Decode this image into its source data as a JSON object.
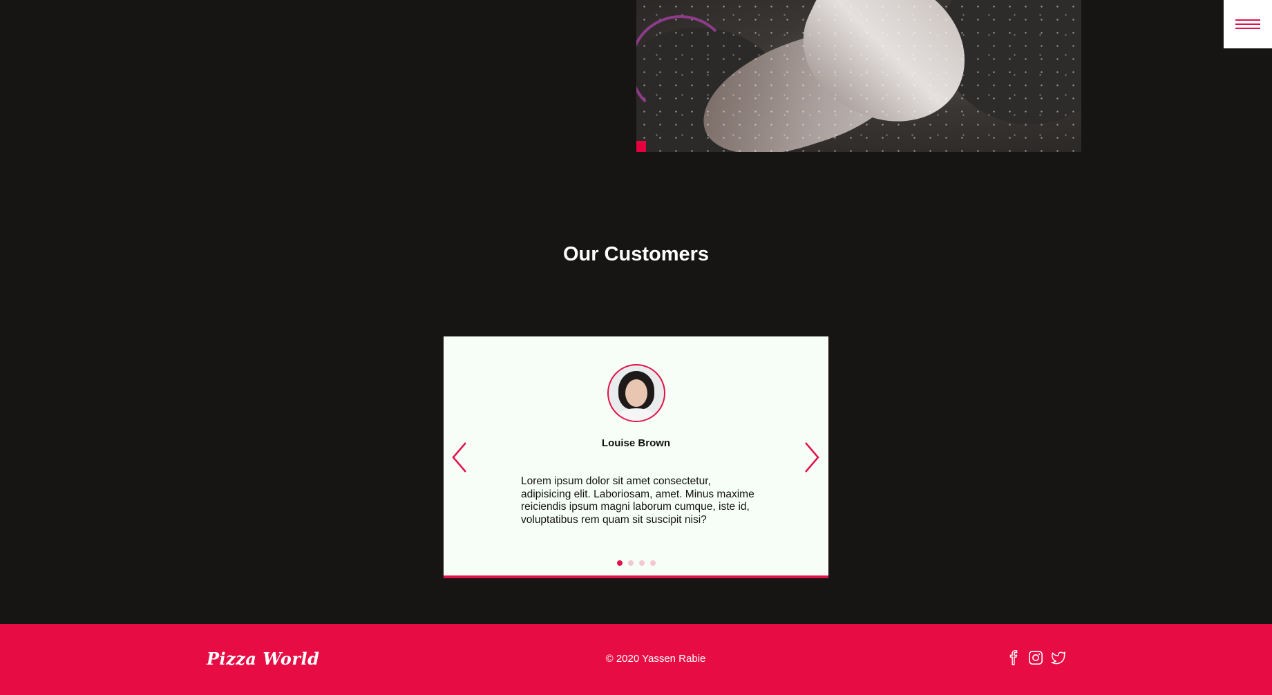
{
  "header": {
    "menu_icon": "hamburger-icon"
  },
  "hero": {
    "image": "hands-with-flour-photo"
  },
  "customers": {
    "title": "Our Customers",
    "testimonial": {
      "name": "Louise Brown",
      "avatar": "customer-avatar-photo",
      "quote": "Lorem ipsum dolor sit amet consectetur, adipisicing elit. Laboriosam, amet. Minus maxime reiciendis ipsum magni laborum cumque, iste id, voluptatibus rem quam sit suscipit nisi?"
    },
    "prev_icon": "chevron-left-icon",
    "next_icon": "chevron-right-icon",
    "pagination": {
      "total": 4,
      "active": 1
    }
  },
  "footer": {
    "brand": "Pizza World",
    "copyright": "© 2020 Yassen Rabie",
    "socials": [
      "facebook-icon",
      "instagram-icon",
      "twitter-icon"
    ]
  },
  "colors": {
    "accent": "#e80c44",
    "background": "#171514",
    "card": "#f7fdf7"
  }
}
